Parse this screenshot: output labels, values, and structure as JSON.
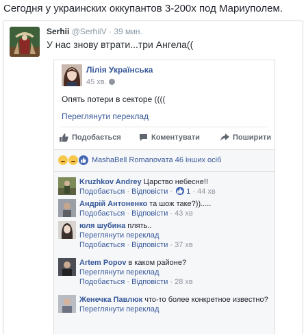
{
  "headline": "Сегодня у украинских оккупантов 3-200х под Мариуполем.",
  "tweet": {
    "name": "Serhii",
    "handle": "@SerhiiV",
    "dot": "·",
    "time": "39 мин.",
    "text": "У нас знову втрати...три Ангела(("
  },
  "post": {
    "author": "Лілія Українська",
    "time": "45 хв.",
    "text": "Опять потери в секторе ((((",
    "translate": "Переглянути переклад",
    "actions": {
      "like": "Подобається",
      "comment": "Коментувати",
      "share": "Поширити"
    },
    "reactions": {
      "names": "MashaBell Romanova",
      "rest": "та 46 інших осіб",
      "icons": [
        "sad-reaction",
        "haha-reaction",
        "like-reaction"
      ]
    }
  },
  "comment_labels": {
    "like": "Подобається",
    "reply": "Відповісти",
    "sep": "·",
    "translate": "Переглянути переклад"
  },
  "comments": [
    {
      "author": "Kruzhkov Andrey",
      "text": "Царство небесне!!",
      "likes": "1",
      "time": "44 хв"
    },
    {
      "author": "Андрій Антоненко",
      "text": "та шож таке?)).....",
      "time": "43 хв"
    },
    {
      "author": "юля шубина",
      "text": "плять..",
      "time": "37 хв"
    },
    {
      "author": "Artem Popov",
      "text": "в каком районе?",
      "time": "28 хв"
    },
    {
      "author": "Женечка Павлюк",
      "text": "что-то более конкретное известно?"
    }
  ],
  "colors": {
    "link": "#365899",
    "meta": "#90949c",
    "border": "#dddfe2",
    "panel": "#f6f7f9",
    "like_blue": "#4267b2"
  }
}
